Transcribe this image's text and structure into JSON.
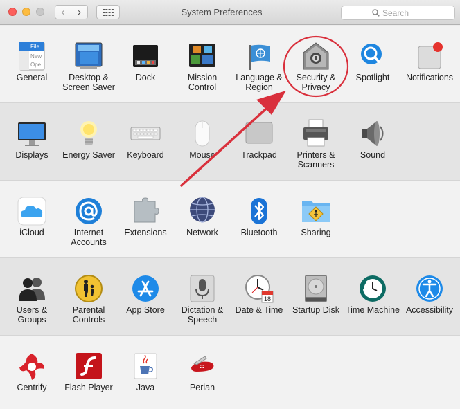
{
  "window": {
    "title": "System Preferences",
    "back_glyph": "‹",
    "forward_glyph": "›",
    "grid_icon": "show-all-icon"
  },
  "search": {
    "placeholder": "Search",
    "icon": "search-icon"
  },
  "panes": [
    {
      "id": "general",
      "label": "General",
      "icon": "general-icon"
    },
    {
      "id": "desktop",
      "label": "Desktop & Screen Saver",
      "icon": "desktop-icon"
    },
    {
      "id": "dock",
      "label": "Dock",
      "icon": "dock-icon"
    },
    {
      "id": "mission",
      "label": "Mission Control",
      "icon": "mission-control-icon"
    },
    {
      "id": "language",
      "label": "Language & Region",
      "icon": "flag-icon"
    },
    {
      "id": "security",
      "label": "Security & Privacy",
      "icon": "house-lock-icon"
    },
    {
      "id": "spotlight",
      "label": "Spotlight",
      "icon": "magnifier-icon"
    },
    {
      "id": "notifications",
      "label": "Notifications",
      "icon": "notification-badge-icon"
    },
    {
      "id": "displays",
      "label": "Displays",
      "icon": "monitor-icon"
    },
    {
      "id": "energy",
      "label": "Energy Saver",
      "icon": "lightbulb-icon"
    },
    {
      "id": "keyboard",
      "label": "Keyboard",
      "icon": "keyboard-icon"
    },
    {
      "id": "mouse",
      "label": "Mouse",
      "icon": "mouse-icon"
    },
    {
      "id": "trackpad",
      "label": "Trackpad",
      "icon": "trackpad-icon"
    },
    {
      "id": "printers",
      "label": "Printers & Scanners",
      "icon": "printer-icon"
    },
    {
      "id": "sound",
      "label": "Sound",
      "icon": "speaker-icon"
    },
    {
      "id": "icloud",
      "label": "iCloud",
      "icon": "cloud-icon"
    },
    {
      "id": "internet",
      "label": "Internet Accounts",
      "icon": "at-sign-icon"
    },
    {
      "id": "extensions",
      "label": "Extensions",
      "icon": "puzzle-icon"
    },
    {
      "id": "network",
      "label": "Network",
      "icon": "globe-icon"
    },
    {
      "id": "bluetooth",
      "label": "Bluetooth",
      "icon": "bluetooth-icon"
    },
    {
      "id": "sharing",
      "label": "Sharing",
      "icon": "folder-sign-icon"
    },
    {
      "id": "users",
      "label": "Users & Groups",
      "icon": "users-icon"
    },
    {
      "id": "parental",
      "label": "Parental Controls",
      "icon": "parental-icon"
    },
    {
      "id": "appstore",
      "label": "App Store",
      "icon": "app-store-icon"
    },
    {
      "id": "dictation",
      "label": "Dictation & Speech",
      "icon": "microphone-icon"
    },
    {
      "id": "datetime",
      "label": "Date & Time",
      "icon": "clock-calendar-icon"
    },
    {
      "id": "startup",
      "label": "Startup Disk",
      "icon": "hard-disk-icon"
    },
    {
      "id": "timemachine",
      "label": "Time Machine",
      "icon": "time-machine-icon"
    },
    {
      "id": "accessibility",
      "label": "Accessibility",
      "icon": "accessibility-icon"
    },
    {
      "id": "centrify",
      "label": "Centrify",
      "icon": "centrify-icon"
    },
    {
      "id": "flash",
      "label": "Flash Player",
      "icon": "flash-icon"
    },
    {
      "id": "java",
      "label": "Java",
      "icon": "java-cup-icon"
    },
    {
      "id": "perian",
      "label": "Perian",
      "icon": "swiss-knife-icon"
    }
  ],
  "thumb_text": {
    "file": "File",
    "new": "New",
    "open": "Ope"
  },
  "calendar_day": "18",
  "colors": {
    "annotation_red": "#d9303c",
    "close_red": "#fc605c",
    "minimize_yellow": "#fdbc40"
  }
}
